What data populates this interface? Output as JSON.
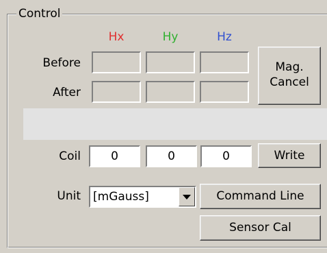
{
  "control": {
    "title": "Control",
    "headers": {
      "hx": "Hx",
      "hy": "Hy",
      "hz": "Hz"
    },
    "colors": {
      "hx": "#e03030",
      "hy": "#30b030",
      "hz": "#3050d0"
    },
    "before_label": "Before",
    "after_label": "After",
    "mag_cancel_label_line1": "Mag.",
    "mag_cancel_label_line2": "Cancel",
    "coil_label": "Coil",
    "coil": {
      "hx": "0",
      "hy": "0",
      "hz": "0"
    },
    "write_label": "Write",
    "unit_label": "Unit",
    "unit_value": "[mGauss]",
    "command_line_label": "Command Line",
    "sensor_cal_label": "Sensor Cal"
  }
}
